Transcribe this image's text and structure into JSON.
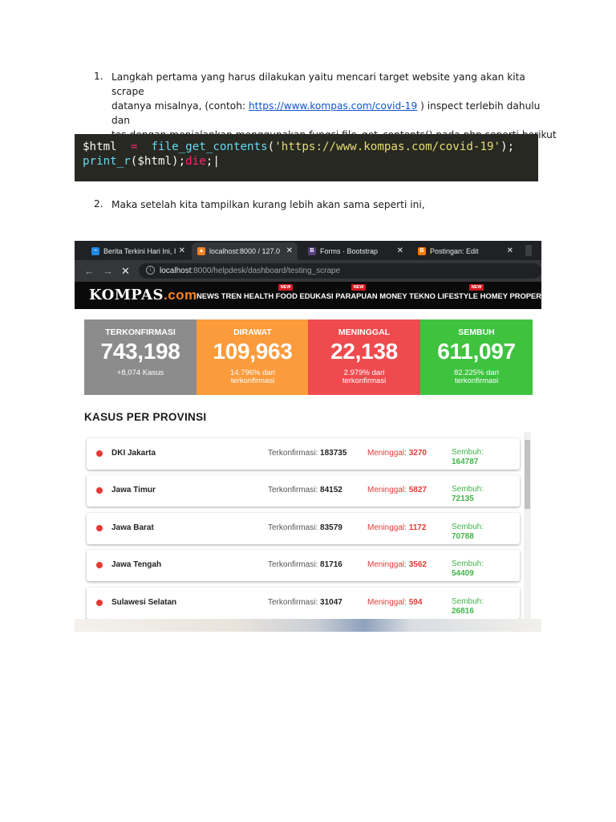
{
  "steps": [
    {
      "number": "1.",
      "line1": "Langkah pertama yang harus dilakukan yaitu mencari target website yang akan kita scrape",
      "line2_before": "datanya misalnya, (contoh: ",
      "line2_link": "https://www.kompas.com/covid-19",
      "line2_after": " ) inspect terlebih dahulu dan",
      "line3": "tes dengan menjalankan menggunakan fungsi file_get_contents() pada php seperti berikut"
    },
    {
      "number": "2.",
      "line1": "Maka setelah kita tampilkan kurang lebih akan sama seperti ini,"
    }
  ],
  "code": {
    "var1": "$html",
    "op": "=",
    "func1": "file_get_contents",
    "open": "(",
    "string": "'https://www.kompas.com/covid-19'",
    "close": ");",
    "func2": "print_r",
    "args2": "($html);",
    "kw": "die",
    "end": ";"
  },
  "browser": {
    "tabs": [
      {
        "label": "Berita Terkini Hari Ini, I",
        "icon": "kompas-favicon",
        "color": "#1e88e5"
      },
      {
        "label": "localhost:8000 / 127.0",
        "icon": "phpmyadmin-favicon",
        "color": "#f58220"
      },
      {
        "label": "Forms · Bootstrap",
        "icon": "bootstrap-favicon",
        "color": "#563d7c"
      },
      {
        "label": "Postingan: Edit",
        "icon": "blogger-favicon",
        "color": "#f57d00"
      }
    ],
    "url_host": "localhost",
    "url_path": ":8000/helpdesk/dashboard/testing_scrape",
    "close_glyph": "✕"
  },
  "kompas": {
    "logo_main": "KOMPAS",
    "logo_dot": ".com",
    "nav": "NEWS TREN HEALTH FOOD EDUKASI PARAPUAN MONEY TEKNO LIFESTYLE HOMEY PROPERTI BOLA T",
    "new_badge": "NEW"
  },
  "stats": [
    {
      "title": "TERKONFIRMASI",
      "value": "743,198",
      "sub1": "+8,074 Kasus",
      "sub2": "",
      "color": "#8c8c8c"
    },
    {
      "title": "DIRAWAT",
      "value": "109,963",
      "sub1": "14.796% dari",
      "sub2": "terkonfirmasi",
      "color": "#fb9b3c"
    },
    {
      "title": "MENINGGAL",
      "value": "22,138",
      "sub1": "2.979% dari",
      "sub2": "terkonfirmasi",
      "color": "#ef4b4f"
    },
    {
      "title": "SEMBUH",
      "value": "611,097",
      "sub1": "82.225% dari",
      "sub2": "terkonfirmasi",
      "color": "#3fc33f"
    }
  ],
  "kasus_title": "KASUS PER PROVINSI",
  "labels": {
    "konfirmasi": "Terkonfirmasi: ",
    "meninggal": "Meninggal: ",
    "sembuh": "Sembuh:"
  },
  "provinsi": [
    {
      "name": "DKI Jakarta",
      "konfirmasi": "183735",
      "meninggal": "3270",
      "sembuh": "164787"
    },
    {
      "name": "Jawa Timur",
      "konfirmasi": "84152",
      "meninggal": "5827",
      "sembuh": "72135"
    },
    {
      "name": "Jawa Barat",
      "konfirmasi": "83579",
      "meninggal": "1172",
      "sembuh": "70788"
    },
    {
      "name": "Jawa Tengah",
      "konfirmasi": "81716",
      "meninggal": "3562",
      "sembuh": "54409"
    },
    {
      "name": "Sulawesi Selatan",
      "konfirmasi": "31047",
      "meninggal": "594",
      "sembuh": "26816"
    }
  ]
}
